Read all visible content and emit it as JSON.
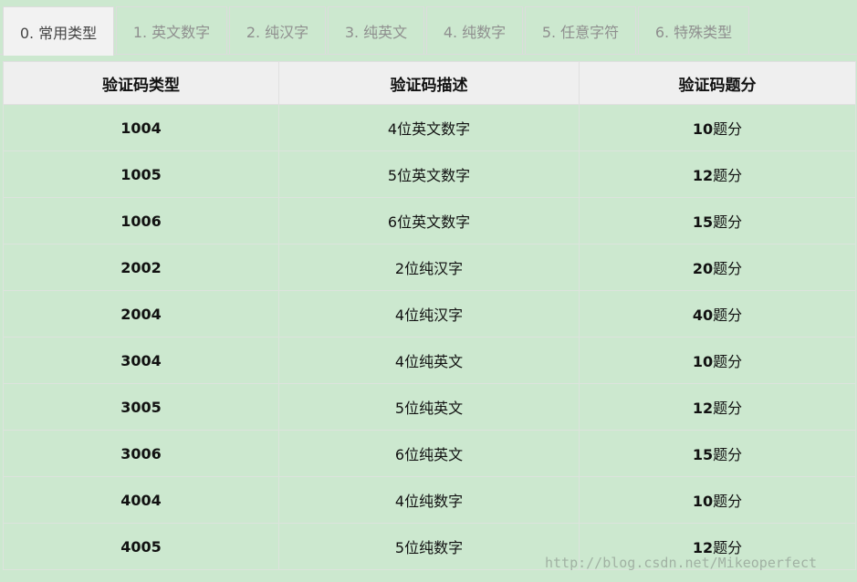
{
  "tabs": [
    {
      "label": "0. 常用类型",
      "active": true
    },
    {
      "label": "1. 英文数字",
      "active": false
    },
    {
      "label": "2. 纯汉字",
      "active": false
    },
    {
      "label": "3. 纯英文",
      "active": false
    },
    {
      "label": "4. 纯数字",
      "active": false
    },
    {
      "label": "5. 任意字符",
      "active": false
    },
    {
      "label": "6. 特殊类型",
      "active": false
    }
  ],
  "table": {
    "headers": [
      "验证码类型",
      "验证码描述",
      "验证码题分"
    ],
    "rows": [
      {
        "code": "1004",
        "desc": "4位英文数字",
        "score": "10",
        "unit": "题分"
      },
      {
        "code": "1005",
        "desc": "5位英文数字",
        "score": "12",
        "unit": "题分"
      },
      {
        "code": "1006",
        "desc": "6位英文数字",
        "score": "15",
        "unit": "题分"
      },
      {
        "code": "2002",
        "desc": "2位纯汉字",
        "score": "20",
        "unit": "题分"
      },
      {
        "code": "2004",
        "desc": "4位纯汉字",
        "score": "40",
        "unit": "题分"
      },
      {
        "code": "3004",
        "desc": "4位纯英文",
        "score": "10",
        "unit": "题分"
      },
      {
        "code": "3005",
        "desc": "5位纯英文",
        "score": "12",
        "unit": "题分"
      },
      {
        "code": "3006",
        "desc": "6位纯英文",
        "score": "15",
        "unit": "题分"
      },
      {
        "code": "4004",
        "desc": "4位纯数字",
        "score": "10",
        "unit": "题分"
      },
      {
        "code": "4005",
        "desc": "5位纯数字",
        "score": "12",
        "unit": "题分"
      }
    ]
  },
  "watermark": "http://blog.csdn.net/Mikeoperfect"
}
